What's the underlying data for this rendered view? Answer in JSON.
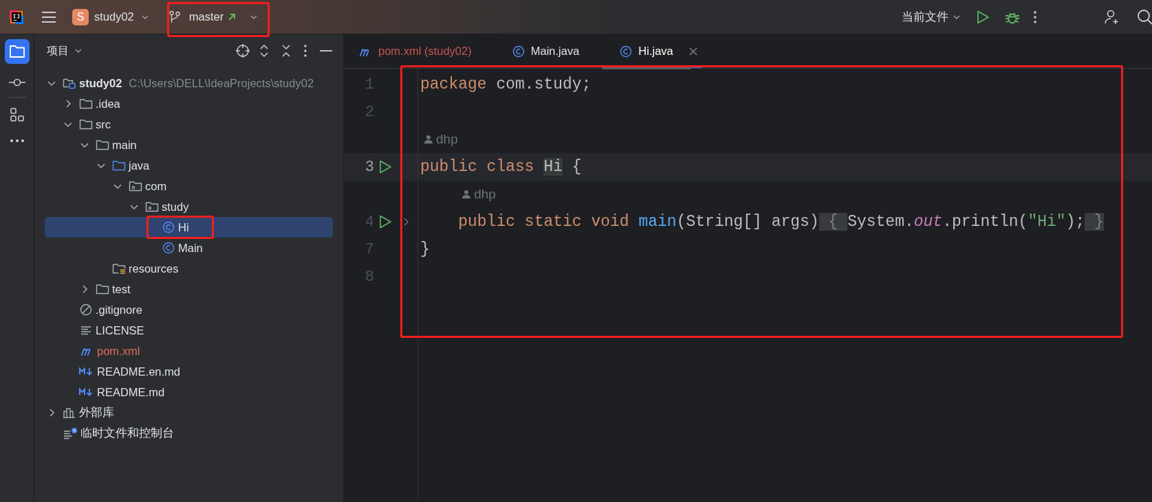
{
  "top_bar": {
    "project_initial": "S",
    "project_name": "study02",
    "branch": "master",
    "run_configuration": "当前文件"
  },
  "project_panel": {
    "title": "项目",
    "tree": [
      {
        "label": "study02",
        "kind": "module",
        "path": "C:\\Users\\DELL\\IdeaProjects\\study02",
        "expanded": true,
        "selected": false,
        "error": false,
        "children": [
          {
            "label": ".idea",
            "kind": "folder",
            "expanded": false,
            "selected": false,
            "error": false
          },
          {
            "label": "src",
            "kind": "folder",
            "expanded": true,
            "selected": false,
            "error": false,
            "children": [
              {
                "label": "main",
                "kind": "folder",
                "expanded": true,
                "selected": false,
                "error": false,
                "children": [
                  {
                    "label": "java",
                    "kind": "sources",
                    "expanded": true,
                    "selected": false,
                    "error": false,
                    "children": [
                      {
                        "label": "com",
                        "kind": "package",
                        "expanded": true,
                        "selected": false,
                        "error": false,
                        "children": [
                          {
                            "label": "study",
                            "kind": "package",
                            "expanded": true,
                            "selected": false,
                            "error": false,
                            "children": [
                              {
                                "label": "Hi",
                                "kind": "class",
                                "selected": true,
                                "error": false
                              },
                              {
                                "label": "Main",
                                "kind": "class",
                                "selected": false,
                                "error": false
                              }
                            ]
                          }
                        ]
                      }
                    ]
                  },
                  {
                    "label": "resources",
                    "kind": "resources",
                    "selected": false,
                    "error": false
                  }
                ]
              },
              {
                "label": "test",
                "kind": "folder",
                "expanded": false,
                "selected": false,
                "error": false
              }
            ]
          },
          {
            "label": ".gitignore",
            "kind": "ignore",
            "selected": false,
            "error": false
          },
          {
            "label": "LICENSE",
            "kind": "text",
            "selected": false,
            "error": false
          },
          {
            "label": "pom.xml",
            "kind": "maven",
            "selected": false,
            "error": true
          },
          {
            "label": "README.en.md",
            "kind": "markdown",
            "selected": false,
            "error": false
          },
          {
            "label": "README.md",
            "kind": "markdown",
            "selected": false,
            "error": false
          }
        ]
      },
      {
        "label": "外部库",
        "kind": "library",
        "expanded": false,
        "selected": false,
        "error": false
      },
      {
        "label": "临时文件和控制台",
        "kind": "scratch",
        "selected": false,
        "error": false
      }
    ]
  },
  "editor": {
    "tabs": [
      {
        "label": "pom.xml (study02)",
        "kind": "maven",
        "selected": false,
        "error": true,
        "closable": false
      },
      {
        "label": "Main.java",
        "kind": "class",
        "selected": false,
        "error": false,
        "closable": false
      },
      {
        "label": "Hi.java",
        "kind": "class",
        "selected": true,
        "error": false,
        "closable": true
      }
    ],
    "lines": [
      {
        "number": "1",
        "runnable": false,
        "folded": false,
        "current": false,
        "tokens": [
          {
            "text": "package",
            "kind": "keyword"
          },
          {
            "text": " com.study;",
            "kind": "plain"
          }
        ]
      },
      {
        "number": "2",
        "runnable": false,
        "folded": false,
        "current": false
      },
      {
        "number": "3",
        "author": "dhp",
        "runnable": true,
        "folded": false,
        "current": true,
        "tokens": [
          {
            "text": "public class ",
            "kind": "keyword"
          },
          {
            "text": "Hi",
            "kind": "usage"
          },
          {
            "text": " {",
            "kind": "plain"
          }
        ]
      },
      {
        "number": "4",
        "author": "dhp",
        "runnable": true,
        "folded": true,
        "current": false,
        "tokens": [
          {
            "text": "    public static void ",
            "kind": "keyword"
          },
          {
            "text": "main",
            "kind": "method"
          },
          {
            "text": "(String[] args)",
            "kind": "plain"
          },
          {
            "text": " { ",
            "kind": "folded"
          },
          {
            "text": "System.",
            "kind": "plain"
          },
          {
            "text": "out",
            "kind": "field"
          },
          {
            "text": ".println(",
            "kind": "plain"
          },
          {
            "text": "\"Hi\"",
            "kind": "string"
          },
          {
            "text": ");",
            "kind": "plain"
          },
          {
            "text": " }",
            "kind": "folded"
          }
        ]
      },
      {
        "number": "7",
        "runnable": false,
        "folded": false,
        "current": false,
        "tokens": [
          {
            "text": "}",
            "kind": "plain"
          }
        ]
      },
      {
        "number": "8",
        "runnable": false,
        "folded": false,
        "current": false
      }
    ]
  }
}
